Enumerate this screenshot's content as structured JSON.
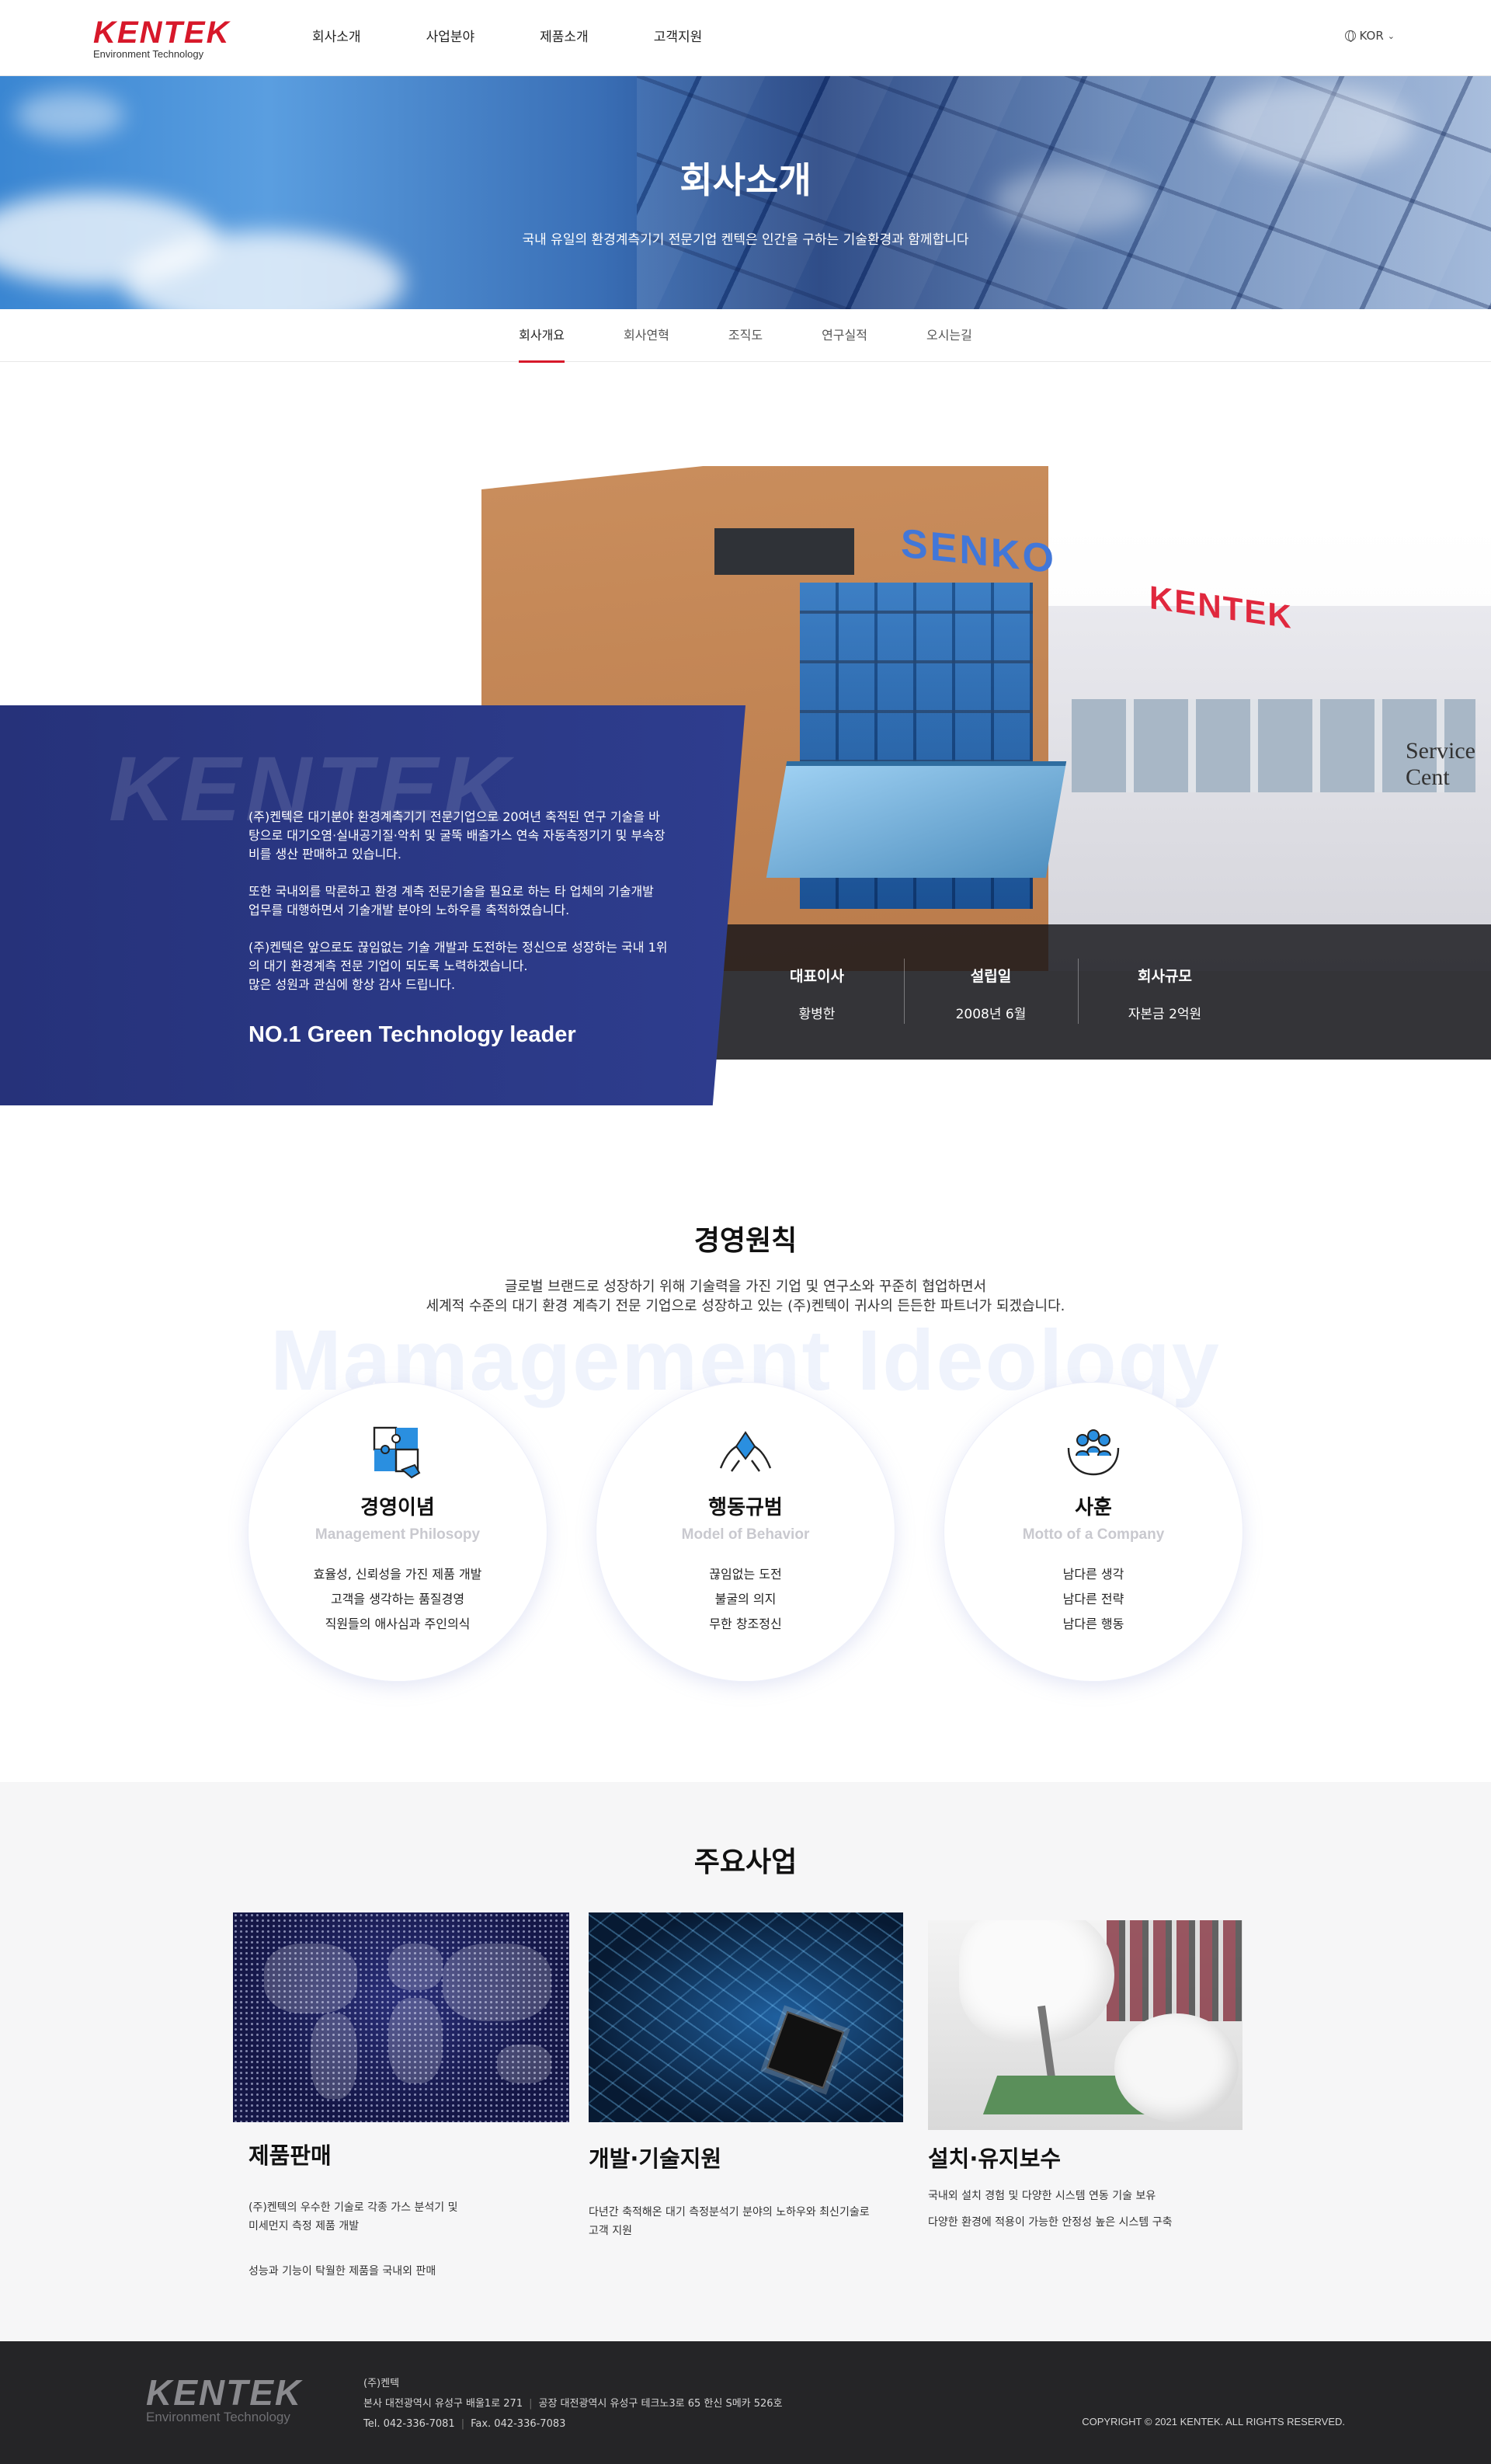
{
  "header": {
    "logo_main": "KENTEK",
    "logo_sub": "Environment Technology",
    "nav": [
      "회사소개",
      "사업분야",
      "제품소개",
      "고객지원"
    ],
    "lang": "KOR"
  },
  "hero": {
    "title": "회사소개",
    "subtitle": "국내 유일의 환경계측기기 전문기업 켄텍은 인간을 구하는 기술환경과 함께합니다"
  },
  "subtabs": [
    "회사개요",
    "회사연혁",
    "조직도",
    "연구실적",
    "오시는길"
  ],
  "overview": {
    "watermark": "KENTEK",
    "paragraphs": [
      "(주)켄텍은 대기분야 환경계측기기 전문기업으로 20여년 축적된 연구 기술을 바탕으로 대기오염·실내공기질·악취 및 굴뚝 배출가스 연속 자동측정기기 및 부속장비를 생산 판매하고 있습니다.",
      "또한 국내외를 막론하고 환경 계측 전문기술을 필요로 하는 타 업체의 기술개발 업무를 대행하면서 기술개발 분야의 노하우를 축적하였습니다.",
      "(주)켄텍은 앞으로도 끊임없는 기술 개발과 도전하는 정신으로 성장하는 국내 1위의 대기 환경계측 전문 기업이 되도록 노력하겠습니다.\n많은 성원과 관심에 항상 감사 드립니다."
    ],
    "slogan": "NO.1 Green Technology leader",
    "building_signs": {
      "senko": "SENKO",
      "kentek": "KENTEK",
      "service": "Service Cent"
    },
    "stats": [
      {
        "label": "대표이사",
        "value": "황병한"
      },
      {
        "label": "설립일",
        "value": "2008년 6월"
      },
      {
        "label": "회사규모",
        "value": "자본금 2억원"
      }
    ]
  },
  "management": {
    "title": "경영원칙",
    "desc_line1": "글로벌 브랜드로 성장하기 위해 기술력을 가진 기업 및 연구소와 꾸준히 협업하면서",
    "desc_line2": "세계적 수준의 대기 환경 계측기 전문 기업으로 성장하고 있는 (주)켄텍이 귀사의 든든한 파트너가 되겠습니다.",
    "bg_text": "Mamagement Ideology",
    "items": [
      {
        "icon": "puzzle-icon",
        "title": "경영이념",
        "en": "Management Philosopy",
        "lines": [
          "효율성, 신뢰성을 가진 제품 개발",
          "고객을 생각하는 품질경영",
          "직원들의 애사심과 주인의식"
        ]
      },
      {
        "icon": "handshake-icon",
        "title": "행동규범",
        "en": "Model of Behavior",
        "lines": [
          "끊임없는 도전",
          "불굴의 의지",
          "무한 창조정신"
        ]
      },
      {
        "icon": "people-hands-icon",
        "title": "사훈",
        "en": "Motto of a Company",
        "lines": [
          "남다른 생각",
          "남다른 전략",
          "남다른 행동"
        ]
      }
    ]
  },
  "business": {
    "title": "주요사업",
    "cards": [
      {
        "title": "제품판매",
        "lines": [
          "(주)켄텍의 우수한 기술로 각종 가스 분석기 및\n미세먼지 측정 제품 개발",
          "성능과 기능이 탁월한 제품을 국내외 판매"
        ]
      },
      {
        "title": "개발·기술지원",
        "lines": [
          "다년간 축적해온 대기 측정분석기 분야의 노하우와 최신기술로\n고객 지원"
        ]
      },
      {
        "title": "설치·유지보수",
        "lines": [
          "국내외 설치 경험 및 다양한 시스템 연동 기술 보유",
          "다양한 환경에 적용이 가능한 안정성 높은 시스템 구축"
        ]
      }
    ]
  },
  "footer": {
    "logo_main": "KENTEK",
    "logo_sub": "Environment Technology",
    "company": "(주)켄텍",
    "hq": "본사  대전광역시 유성구 배울1로 271",
    "factory": "공장  대전광역시 유성구 테크노3로 65 한신 S메카 526호",
    "tel": "Tel. 042-336-7081",
    "fax": "Fax. 042-336-7083",
    "copyright": "COPYRIGHT © 2021 KENTEK. ALL RIGHTS RESERVED."
  }
}
